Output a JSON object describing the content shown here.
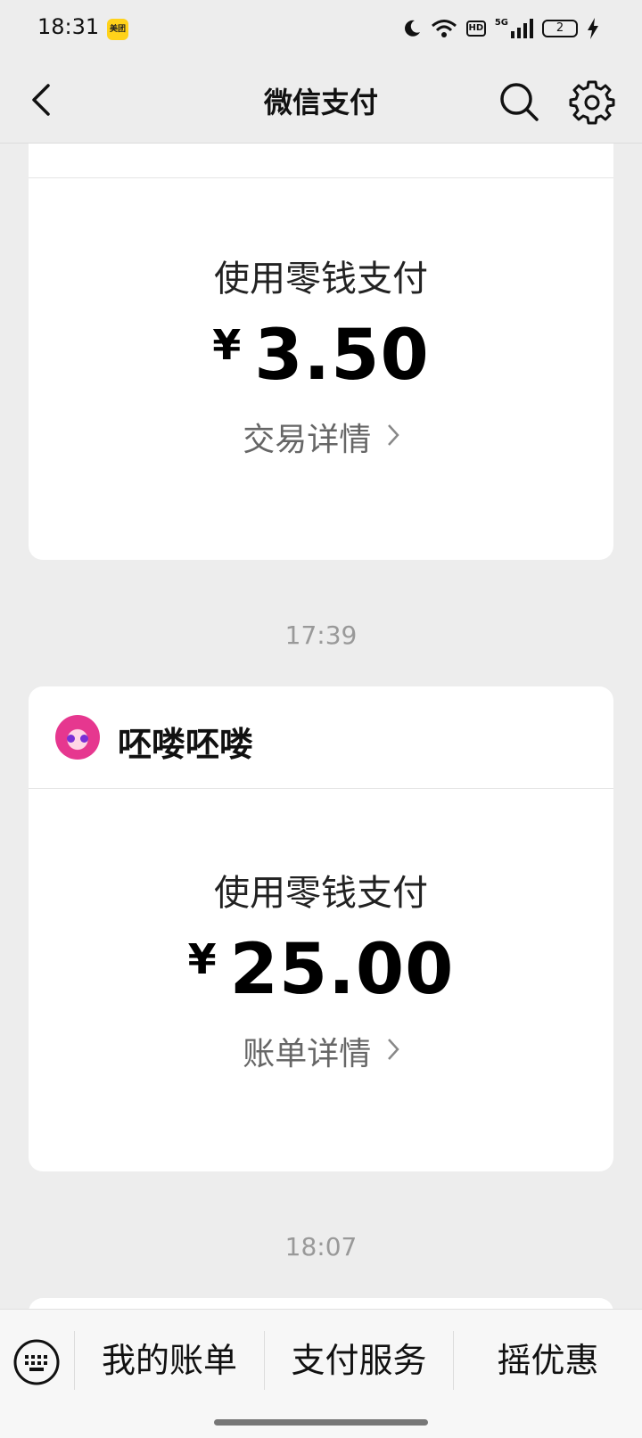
{
  "status_bar": {
    "time": "18:31",
    "app_badge": "美团",
    "network": "5G",
    "hd": "HD",
    "battery_level": "2",
    "icons": [
      "moon-icon",
      "wifi-icon",
      "hd-icon",
      "signal-icon",
      "battery-icon",
      "charging-icon"
    ]
  },
  "nav": {
    "title": "微信支付",
    "back_icon": "chevron-left-icon",
    "search_icon": "search-icon",
    "settings_icon": "gear-icon"
  },
  "cards": [
    {
      "pay_method": "使用零钱支付",
      "currency": "¥",
      "amount": "3.50",
      "detail_label": "交易详情"
    },
    {
      "merchant": "呸喽呸喽",
      "pay_method": "使用零钱支付",
      "currency": "¥",
      "amount": "25.00",
      "detail_label": "账单详情"
    }
  ],
  "timestamps": [
    "17:39",
    "18:07"
  ],
  "bottom_menu": {
    "keyboard_icon": "keyboard-icon",
    "items": [
      "我的账单",
      "支付服务",
      "摇优惠"
    ]
  },
  "colors": {
    "background": "#ededed",
    "card": "#ffffff",
    "text_primary": "#111111",
    "text_secondary": "#666666",
    "timestamp": "#999999"
  }
}
